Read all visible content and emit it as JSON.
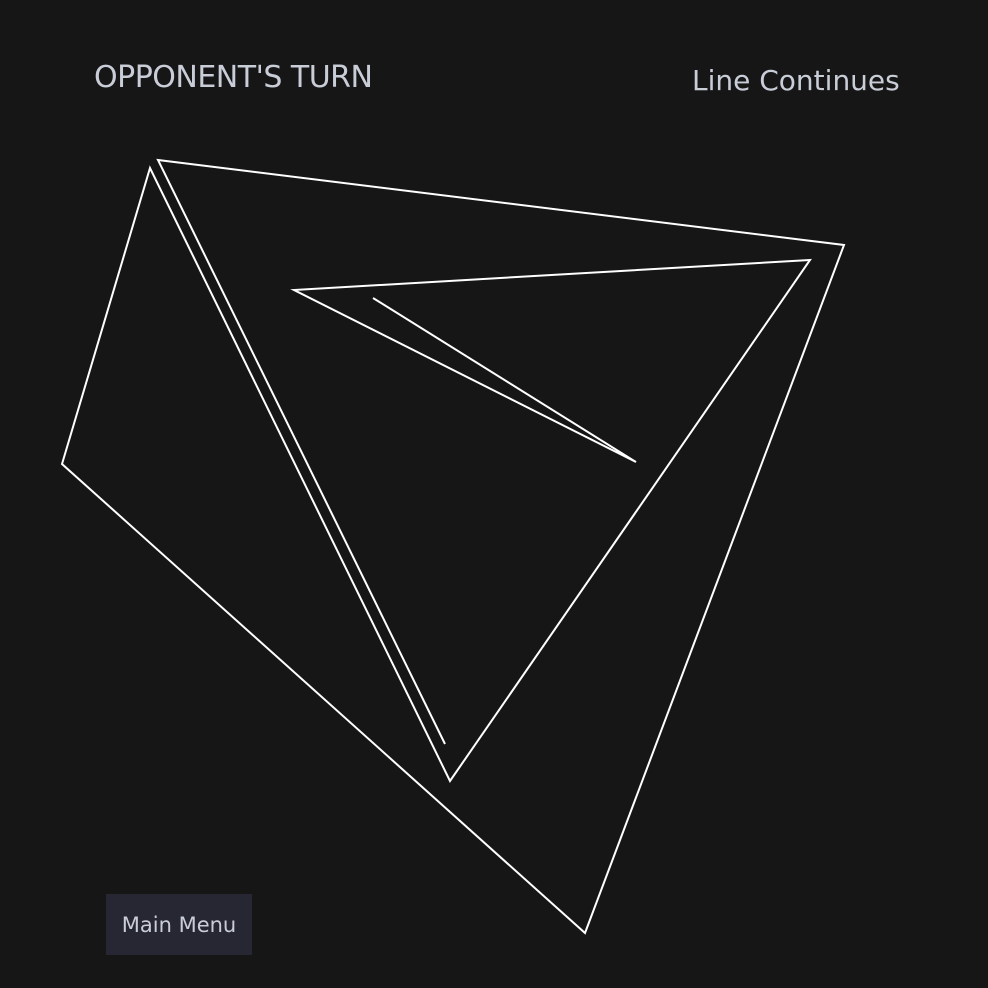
{
  "header": {
    "turn_text": "OPPONENT'S TURN",
    "status_text": "Line Continues"
  },
  "footer": {
    "menu_label": "Main Menu"
  },
  "colors": {
    "background": "#161616",
    "line": "#ffffff",
    "text": "#c9cdd8",
    "button_bg": "#272733"
  }
}
